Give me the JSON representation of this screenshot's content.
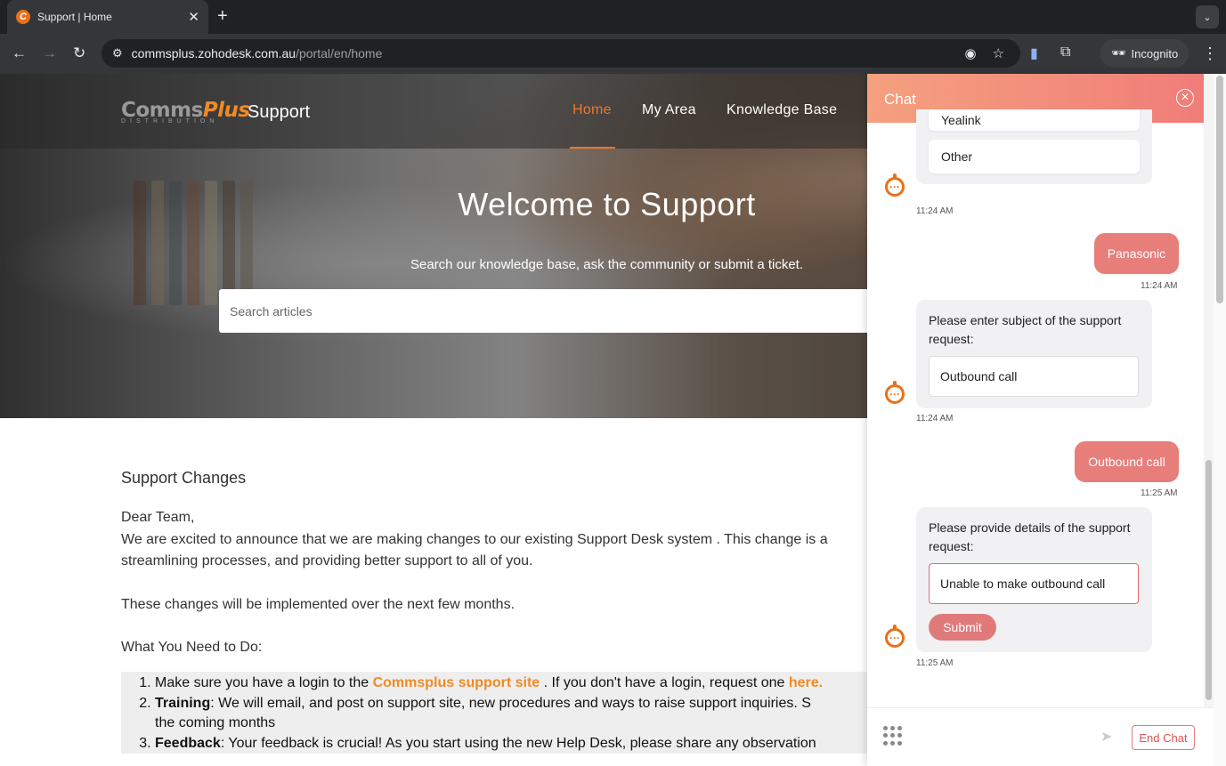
{
  "browser": {
    "tab_title": "Support | Home",
    "tab_favicon": "commsplus-c-icon",
    "tab_close": "✕",
    "new_tab": "+",
    "url_host": "commsplus.zohodesk.com.au",
    "url_path": "/portal/en/home",
    "incognito_label": "Incognito"
  },
  "header": {
    "logo_main": "Comms",
    "logo_plus": "Plus",
    "logo_sub": "DISTRIBUTION",
    "logo_support": "Support",
    "nav": [
      "Home",
      "My Area",
      "Knowledge Base"
    ],
    "active_nav": "Home",
    "accent": "#f0762a"
  },
  "hero": {
    "title": "Welcome to Support",
    "subtitle": "Search our knowledge base, ask the community or submit a ticket.",
    "search_placeholder": "Search articles"
  },
  "content": {
    "title": "Support Changes",
    "greeting": "Dear Team,",
    "para1_line1": "We are excited to announce that we are making changes to our existing Support Desk system . This change is a",
    "para1_line2": "streamlining processes, and providing better support to all of you.",
    "para2": "These changes will be implemented over the next few months.",
    "what_to_do": "What You Need to Do:",
    "list": {
      "item1_a": "Make sure you have a login to the ",
      "item1_link": "Commsplus support site",
      "item1_b": " . If you don't have a login, request one ",
      "item1_link2": "here.",
      "item2_bold": "Training",
      "item2_text": ": We will email, and post on support site, new procedures and ways to raise support inquiries. S",
      "item2_text2": "the coming months",
      "item3_bold": "Feedback",
      "item3_text": ": Your feedback is crucial! As you start using the new Help Desk, please share any observation"
    }
  },
  "chat": {
    "title": "Chat",
    "brand_color": "#e77e7a",
    "messages": {
      "options": [
        "Yealink",
        "Other"
      ],
      "ts1": "11:24 AM",
      "user1": "Panasonic",
      "ts2": "11:24 AM",
      "bot2_text": "Please enter subject of the support request:",
      "bot2_value": "Outbound call",
      "ts3": "11:24 AM",
      "user2": "Outbound call",
      "ts4": "11:25 AM",
      "bot3_text": "Please provide details of the support request:",
      "bot3_value": "Unable to make outbound call",
      "submit": "Submit",
      "ts5": "11:25 AM"
    },
    "end_chat": "End Chat"
  }
}
